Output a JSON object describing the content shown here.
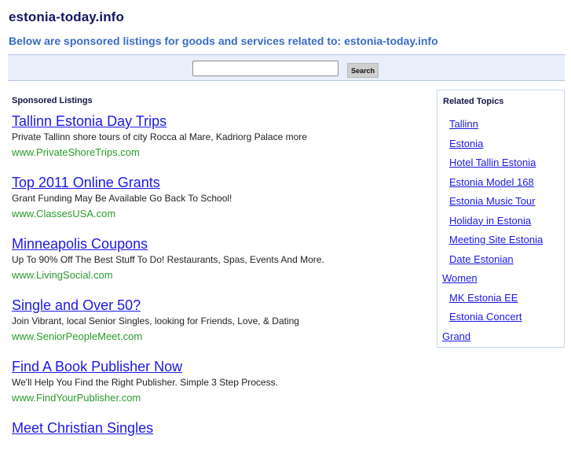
{
  "header": {
    "title": "estonia-today.info",
    "subtitle": "Below are sponsored listings for goods and services related to: estonia-today.info"
  },
  "search": {
    "value": "",
    "placeholder": "",
    "button_label": "Search"
  },
  "colors": {
    "title": "#151565",
    "subtitle": "#3b6bc9",
    "link": "#1a1ae6",
    "url": "#2a9a2a",
    "search_bar_bg": "#e8eefa"
  },
  "listings": {
    "heading": "Sponsored Listings",
    "items": [
      {
        "title": "Tallinn Estonia Day Trips",
        "description": "Private Tallinn shore tours of city Rocca al Mare, Kadriorg Palace more",
        "url": "www.PrivateShoreTrips.com"
      },
      {
        "title": "Top 2011 Online Grants",
        "description": "Grant Funding May Be Available Go Back To School!",
        "url": "www.ClassesUSA.com"
      },
      {
        "title": "Minneapolis Coupons",
        "description": "Up To 90% Off The Best Stuff To Do! Restaurants, Spas, Events And More.",
        "url": "www.LivingSocial.com"
      },
      {
        "title": "Single and Over 50?",
        "description": "Join Vibrant, local Senior Singles, looking for Friends, Love, & Dating",
        "url": "www.SeniorPeopleMeet.com"
      },
      {
        "title": "Find A Book Publisher Now",
        "description": "We'll Help You Find the Right Publisher. Simple 3 Step Process.",
        "url": "www.FindYourPublisher.com"
      },
      {
        "title": "Meet Christian Singles",
        "description": "",
        "url": ""
      }
    ]
  },
  "related_topics": {
    "heading": "Related Topics",
    "items": [
      {
        "label": "Tallinn"
      },
      {
        "label": "Estonia"
      },
      {
        "label": "Hotel Tallin Estonia"
      },
      {
        "label": "Estonia Model 168"
      },
      {
        "label": "Estonia Music Tour"
      },
      {
        "label": "Holiday in Estonia"
      },
      {
        "label": "Meeting Site Estonia"
      },
      {
        "label": "Date Estonian"
      },
      {
        "label": "Women"
      },
      {
        "label": "MK Estonia EE"
      },
      {
        "label": "Estonia Concert"
      },
      {
        "label": "Grand"
      }
    ]
  }
}
